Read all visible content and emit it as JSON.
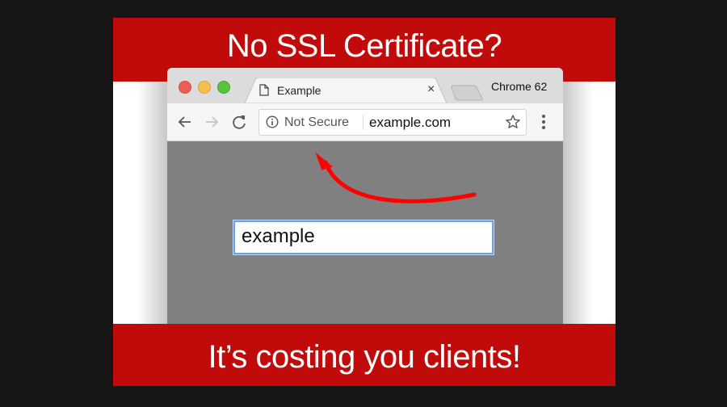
{
  "banner": {
    "headline_top": "No SSL Certificate?",
    "headline_bottom": "It’s costing you clients!",
    "band_color": "#c10a0a"
  },
  "browser": {
    "brand_label": "Chrome 62",
    "window_controls": [
      "close",
      "minimize",
      "zoom"
    ],
    "tab": {
      "title": "Example",
      "icon": "document-icon",
      "close_glyph": "×"
    },
    "toolbar": {
      "back_icon": "arrow-left-icon",
      "forward_icon": "arrow-right-icon",
      "reload_icon": "reload-icon",
      "security_icon": "info-circle-icon",
      "security_text": "Not Secure",
      "url": "example.com",
      "bookmark_icon": "star-icon",
      "menu_icon": "kebab-menu-icon"
    },
    "page": {
      "input_value": "example",
      "annotation": "red-arrow-pointing-to-not-secure"
    }
  }
}
